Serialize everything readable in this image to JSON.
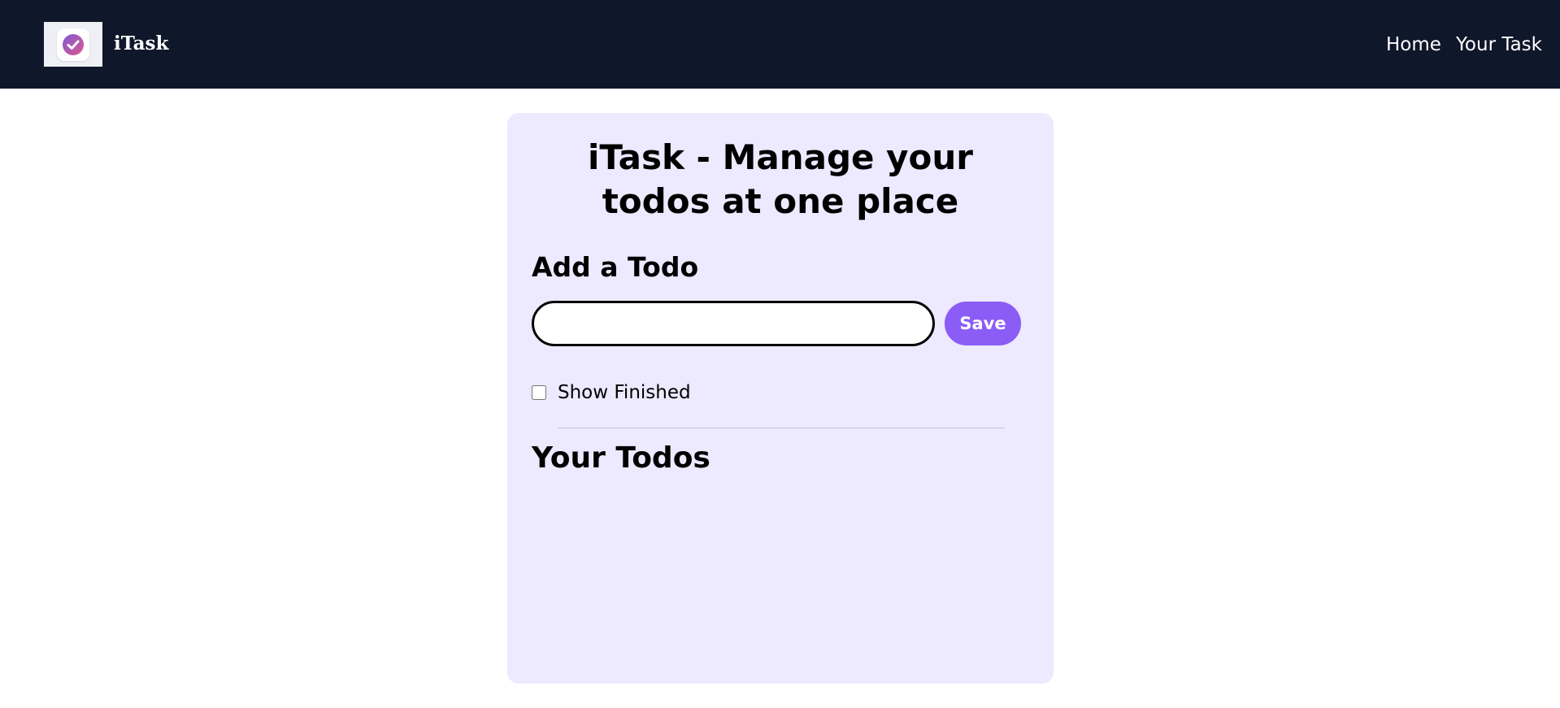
{
  "navbar": {
    "brand_name": "iTask",
    "links": [
      {
        "label": "Home"
      },
      {
        "label": "Your Task"
      }
    ],
    "background_color": "#0f172a"
  },
  "card": {
    "title": "iTask - Manage your todos at one place",
    "add_heading": "Add a Todo",
    "input": {
      "value": "",
      "placeholder": ""
    },
    "save_label": "Save",
    "show_finished_label": "Show Finished",
    "show_finished_checked": false,
    "todos_heading": "Your Todos",
    "background_color": "#ede9fe",
    "accent_color": "#8b5cf6"
  },
  "icons": {
    "logo": "check-badge-icon"
  }
}
